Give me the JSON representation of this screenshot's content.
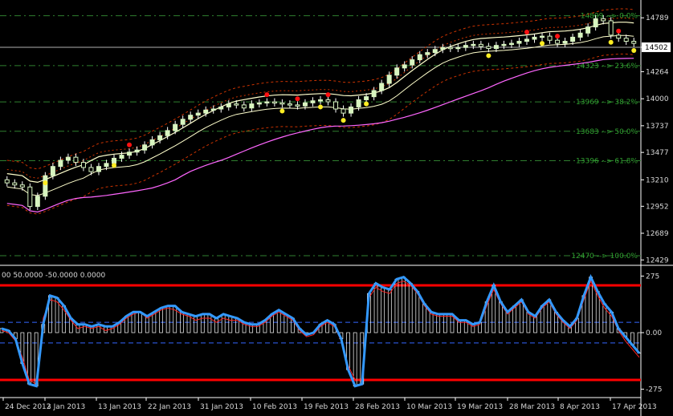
{
  "chart_data": [
    {
      "type": "candlestick",
      "title": "",
      "price_axis": {
        "ticks": [
          "14789",
          "14502",
          "14264",
          "14000",
          "13737",
          "13477",
          "13210",
          "12952",
          "12689",
          "12429"
        ],
        "range": [
          12400,
          14900
        ]
      },
      "current_price": "14502",
      "fibonacci_levels": [
        {
          "label": "14809 --> 0.0%",
          "value": 14809
        },
        {
          "label": "14323 --> 23.6%",
          "value": 14323
        },
        {
          "label": "13969 --> 38.2%",
          "value": 13969
        },
        {
          "label": "13683 --> 50.0%",
          "value": 13683
        },
        {
          "label": "13396 --> 61.8%",
          "value": 13396
        },
        {
          "label": "12470 --> 100.0%",
          "value": 12470
        }
      ],
      "close_series": [
        13180,
        13160,
        13140,
        12950,
        13050,
        13250,
        13340,
        13400,
        13430,
        13380,
        13330,
        13290,
        13340,
        13370,
        13420,
        13450,
        13480,
        13500,
        13550,
        13600,
        13640,
        13690,
        13750,
        13800,
        13840,
        13860,
        13890,
        13900,
        13920,
        13950,
        13940,
        13910,
        13950,
        13960,
        13970,
        13960,
        13950,
        13940,
        13930,
        13960,
        13980,
        13990,
        13970,
        13900,
        13860,
        13920,
        13990,
        14020,
        14080,
        14150,
        14230,
        14300,
        14330,
        14380,
        14430,
        14450,
        14480,
        14500,
        14490,
        14500,
        14520,
        14530,
        14510,
        14490,
        14520,
        14530,
        14540,
        14560,
        14580,
        14600,
        14610,
        14570,
        14540,
        14560,
        14600,
        14640,
        14700,
        14780,
        14760,
        14620,
        14590,
        14560,
        14540
      ]
    },
    {
      "type": "line",
      "title": "",
      "header": "00 50.0000 -50.0000 0.0000",
      "y_ticks": [
        "275",
        "0.00",
        "-275"
      ],
      "ylim": [
        -300,
        300
      ],
      "levels": [
        230,
        50,
        -50,
        -230
      ],
      "series": [
        {
          "values": [
            20,
            10,
            -30,
            -150,
            -250,
            -260,
            40,
            180,
            170,
            130,
            70,
            40,
            40,
            30,
            40,
            30,
            30,
            50,
            80,
            100,
            100,
            80,
            100,
            120,
            130,
            130,
            100,
            90,
            80,
            90,
            90,
            70,
            90,
            80,
            70,
            50,
            40,
            40,
            60,
            90,
            110,
            90,
            70,
            20,
            -10,
            0,
            40,
            60,
            40,
            -30,
            -180,
            -260,
            -250,
            190,
            240,
            220,
            210,
            260,
            270,
            240,
            200,
            140,
            100,
            90,
            90,
            90,
            60,
            60,
            40,
            50,
            150,
            230,
            150,
            100,
            130,
            160,
            100,
            80,
            130,
            160,
            100,
            60,
            30,
            70,
            180,
            270,
            200,
            140,
            100,
            20,
            -20,
            -60,
            -100
          ]
        },
        {
          "values": [
            10,
            0,
            -40,
            -120,
            -230,
            -250,
            70,
            160,
            150,
            110,
            60,
            20,
            30,
            20,
            30,
            10,
            20,
            40,
            70,
            90,
            100,
            70,
            90,
            110,
            120,
            110,
            90,
            80,
            60,
            70,
            70,
            50,
            70,
            60,
            60,
            40,
            30,
            30,
            50,
            80,
            100,
            80,
            60,
            10,
            -20,
            -10,
            30,
            50,
            30,
            -40,
            -160,
            -230,
            -230,
            170,
            220,
            200,
            190,
            240,
            250,
            230,
            190,
            130,
            90,
            80,
            80,
            80,
            50,
            50,
            30,
            40,
            130,
            210,
            140,
            90,
            120,
            150,
            90,
            70,
            120,
            150,
            90,
            50,
            20,
            60,
            160,
            250,
            180,
            120,
            80,
            10,
            -40,
            -80,
            -120
          ]
        },
        {
          "values": [
            20,
            10,
            -30,
            -150,
            -250,
            -260,
            40,
            180,
            170,
            130,
            70,
            40,
            40,
            30,
            40,
            30,
            30,
            50,
            80,
            100,
            100,
            80,
            100,
            120,
            130,
            130,
            100,
            90,
            80,
            90,
            90,
            70,
            90,
            80,
            70,
            50,
            40,
            40,
            60,
            90,
            110,
            90,
            70,
            20,
            -10,
            0,
            40,
            60,
            40,
            -30,
            -180,
            -260,
            -250,
            190,
            240,
            220,
            210,
            260,
            270,
            240,
            200,
            140,
            100,
            90,
            90,
            90,
            60,
            60,
            40,
            50,
            150,
            230,
            150,
            100,
            130,
            160,
            100,
            80,
            130,
            160,
            100,
            60,
            30,
            70,
            180,
            270,
            200,
            140,
            100,
            20,
            -20,
            -60,
            -100
          ]
        }
      ],
      "x_ticks": [
        "24 Dec 2012",
        "3 Jan 2013",
        "13 Jan 2013",
        "22 Jan 2013",
        "31 Jan 2013",
        "10 Feb 2013",
        "19 Feb 2013",
        "28 Feb 2013",
        "10 Mar 2013",
        "19 Mar 2013",
        "28 Mar 2013",
        "8 Apr 2013",
        "17 Apr 2013"
      ]
    }
  ],
  "colors": {
    "background": "#000000",
    "candle": "#d8f5c0",
    "candle_outline": "#ffffff",
    "upper_band": "#ffffcc",
    "mid_line": "#ff66ff",
    "red_band": "#cc3300",
    "fib_line": "#2f7f2f",
    "osc_histogram": "#ffffff",
    "osc_main": "#3399ff",
    "osc_signal": "#ff2222",
    "osc_levels": "#ff0000",
    "osc_inner_levels": "#3366ff",
    "up_dot": "#ffee22",
    "down_dot": "#ff1111"
  }
}
